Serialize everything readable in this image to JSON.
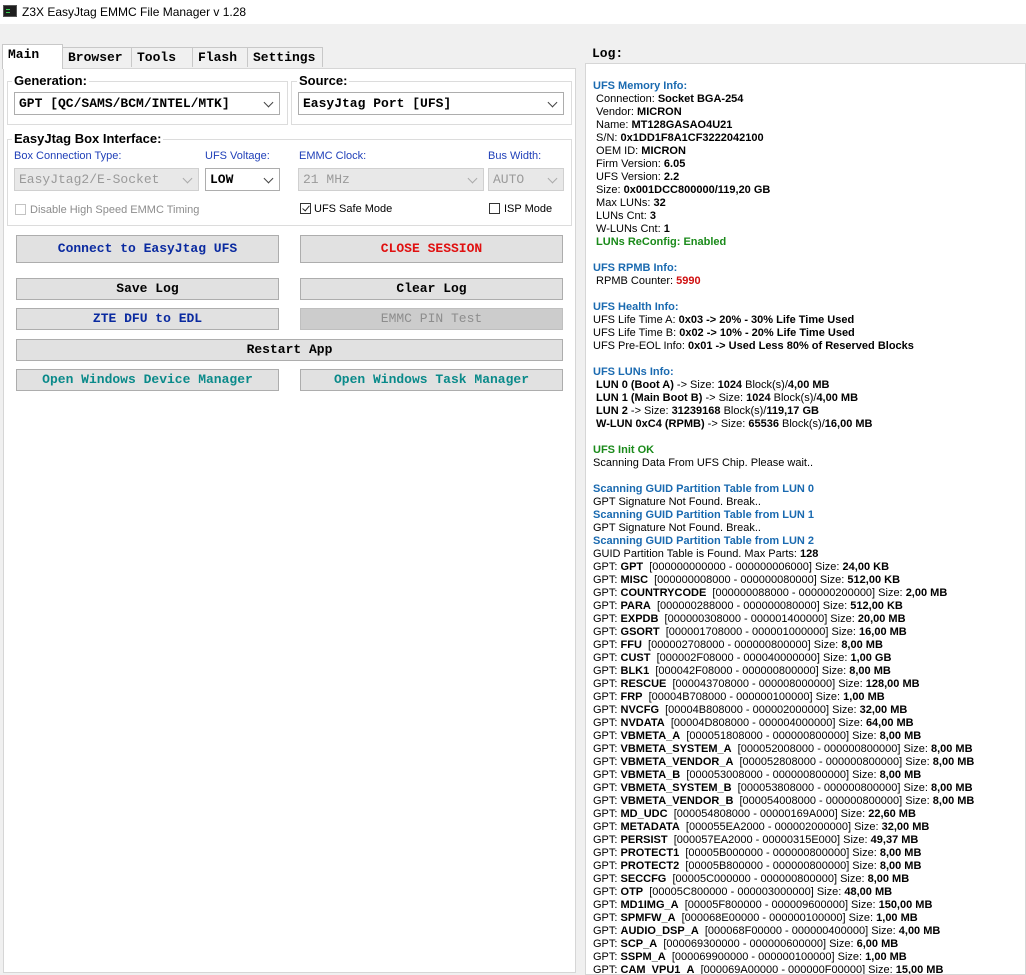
{
  "window": {
    "title": "Z3X EasyJtag EMMC File Manager v 1.28"
  },
  "tabs": [
    "Main",
    "Browser",
    "Tools",
    "Flash",
    "Settings"
  ],
  "generation": {
    "label": "Generation:",
    "value": "GPT [QC/SAMS/BCM/INTEL/MTK]"
  },
  "source": {
    "label": "Source:",
    "value": "EasyJtag Port [UFS]"
  },
  "box_interface": {
    "label": "EasyJtag Box Interface:",
    "conn_type": {
      "label": "Box Connection Type:",
      "value": "EasyJtag2/E-Socket"
    },
    "ufs_voltage": {
      "label": "UFS Voltage:",
      "value": "LOW"
    },
    "emmc_clock": {
      "label": "EMMC Clock:",
      "value": "21 MHz"
    },
    "bus_width": {
      "label": "Bus Width:",
      "value": "AUTO"
    },
    "disable_hs": {
      "label": "Disable High Speed EMMC Timing",
      "checked": false
    },
    "ufs_safe": {
      "label": "UFS Safe Mode",
      "checked": true
    },
    "isp_mode": {
      "label": "ISP Mode",
      "checked": false
    }
  },
  "buttons": {
    "connect": "Connect to EasyJtag UFS",
    "close": "CLOSE SESSION",
    "save_log": "Save Log",
    "clear_log": "Clear Log",
    "zte": "ZTE DFU to EDL",
    "emmc_pin": "EMMC PIN Test",
    "restart": "Restart App",
    "dev_mgr": "Open Windows Device Manager",
    "task_mgr": "Open Windows Task Manager"
  },
  "colors": {
    "connect": "#0a2aa0",
    "close": "#e01010",
    "zte": "#0a2aa0",
    "teal": "#0a8a8a"
  },
  "log": {
    "label": "Log:",
    "lines": [
      {
        "t": "sec",
        "a": "UFS Memory Info:"
      },
      {
        "t": "kv",
        "a": " Connection: ",
        "b": "Socket BGA-254"
      },
      {
        "t": "kv",
        "a": " Vendor: ",
        "b": "MICRON"
      },
      {
        "t": "kv",
        "a": " Name: ",
        "b": "MT128GASAO4U21"
      },
      {
        "t": "kv",
        "a": " S/N: ",
        "b": "0x1DD1F8A1CF3222042100"
      },
      {
        "t": "kv",
        "a": " OEM ID: ",
        "b": "MICRON"
      },
      {
        "t": "kv",
        "a": " Firm Version: ",
        "b": "6.05"
      },
      {
        "t": "kv",
        "a": " UFS Version: ",
        "b": "2.2"
      },
      {
        "t": "kv",
        "a": " Size: ",
        "b": "0x001DCC800000/119,20 GB"
      },
      {
        "t": "kv",
        "a": " Max LUNs: ",
        "b": "32"
      },
      {
        "t": "kv",
        "a": " LUNs Cnt: ",
        "b": "3"
      },
      {
        "t": "kv",
        "a": " W-LUNs Cnt: ",
        "b": "1"
      },
      {
        "t": "ok",
        "a": " LUNs ReConfig: Enabled"
      },
      {
        "t": "gap"
      },
      {
        "t": "sec",
        "a": "UFS RPMB Info:"
      },
      {
        "t": "kvr",
        "a": " RPMB Counter: ",
        "b": "5990"
      },
      {
        "t": "gap"
      },
      {
        "t": "sec",
        "a": "UFS Health Info:"
      },
      {
        "t": "kvk",
        "a": "UFS Life Time A: ",
        "b": "0x03 -> 20% - 30% Life Time Used"
      },
      {
        "t": "kvk",
        "a": "UFS Life Time B: ",
        "b": "0x02 -> 10% - 20% Life Time Used"
      },
      {
        "t": "kvk",
        "a": "UFS Pre-EOL Info: ",
        "b": "0x01 -> Used Less 80% of Reserved Blocks"
      },
      {
        "t": "gap"
      },
      {
        "t": "sec",
        "a": "UFS LUNs Info:"
      },
      {
        "t": "lun",
        "a": " LUN 0 (Boot A)",
        "b": " -> Size: ",
        "c": "1024",
        "d": " Block(s)/",
        "e": "4,00 MB"
      },
      {
        "t": "lun",
        "a": " LUN 1 (Main Boot B)",
        "b": " -> Size: ",
        "c": "1024",
        "d": " Block(s)/",
        "e": "4,00 MB"
      },
      {
        "t": "lun",
        "a": " LUN 2",
        "b": " -> Size: ",
        "c": "31239168",
        "d": " Block(s)/",
        "e": "119,17 GB"
      },
      {
        "t": "lun",
        "a": " W-LUN 0xC4 (RPMB)",
        "b": " -> Size: ",
        "c": "65536",
        "d": " Block(s)/",
        "e": "16,00 MB"
      },
      {
        "t": "gap"
      },
      {
        "t": "ok",
        "a": "UFS Init OK"
      },
      {
        "t": "plain",
        "a": "Scanning Data From UFS Chip. Please wait.."
      },
      {
        "t": "gap"
      },
      {
        "t": "sec",
        "a": "Scanning GUID Partition Table from LUN 0"
      },
      {
        "t": "plain",
        "a": "GPT Signature Not Found. Break.."
      },
      {
        "t": "sec",
        "a": "Scanning GUID Partition Table from LUN 1"
      },
      {
        "t": "plain",
        "a": "GPT Signature Not Found. Break.."
      },
      {
        "t": "sec",
        "a": "Scanning GUID Partition Table from LUN 2"
      },
      {
        "t": "kv",
        "a": "GUID Partition Table is Found. Max Parts: ",
        "b": "128"
      },
      {
        "t": "gpt",
        "a": "GPT",
        "r": "000000000000 - 000000006000",
        "s": "24,00 KB"
      },
      {
        "t": "gpt",
        "a": "MISC",
        "r": "000000008000 - 000000080000",
        "s": "512,00 KB"
      },
      {
        "t": "gpt",
        "a": "COUNTRYCODE",
        "r": "000000088000 - 000000200000",
        "s": "2,00 MB"
      },
      {
        "t": "gpt",
        "a": "PARA",
        "r": "000000288000 - 000000080000",
        "s": "512,00 KB"
      },
      {
        "t": "gpt",
        "a": "EXPDB",
        "r": "000000308000 - 000001400000",
        "s": "20,00 MB"
      },
      {
        "t": "gpt",
        "a": "GSORT",
        "r": "000001708000 - 000001000000",
        "s": "16,00 MB"
      },
      {
        "t": "gpt",
        "a": "FFU",
        "r": "000002708000 - 000000800000",
        "s": "8,00 MB"
      },
      {
        "t": "gpt",
        "a": "CUST",
        "r": "000002F08000 - 000040000000",
        "s": "1,00 GB"
      },
      {
        "t": "gpt",
        "a": "BLK1",
        "r": "000042F08000 - 000000800000",
        "s": "8,00 MB"
      },
      {
        "t": "gpt",
        "a": "RESCUE",
        "r": "000043708000 - 000008000000",
        "s": "128,00 MB"
      },
      {
        "t": "gpt",
        "a": "FRP",
        "r": "00004B708000 - 000000100000",
        "s": "1,00 MB"
      },
      {
        "t": "gpt",
        "a": "NVCFG",
        "r": "00004B808000 - 000002000000",
        "s": "32,00 MB"
      },
      {
        "t": "gpt",
        "a": "NVDATA",
        "r": "00004D808000 - 000004000000",
        "s": "64,00 MB"
      },
      {
        "t": "gpt",
        "a": "VBMETA_A",
        "r": "000051808000 - 000000800000",
        "s": "8,00 MB"
      },
      {
        "t": "gpt",
        "a": "VBMETA_SYSTEM_A",
        "r": "000052008000 - 000000800000",
        "s": "8,00 MB"
      },
      {
        "t": "gpt",
        "a": "VBMETA_VENDOR_A",
        "r": "000052808000 - 000000800000",
        "s": "8,00 MB"
      },
      {
        "t": "gpt",
        "a": "VBMETA_B",
        "r": "000053008000 - 000000800000",
        "s": "8,00 MB"
      },
      {
        "t": "gpt",
        "a": "VBMETA_SYSTEM_B",
        "r": "000053808000 - 000000800000",
        "s": "8,00 MB"
      },
      {
        "t": "gpt",
        "a": "VBMETA_VENDOR_B",
        "r": "000054008000 - 000000800000",
        "s": "8,00 MB"
      },
      {
        "t": "gpt",
        "a": "MD_UDC",
        "r": "000054808000 - 00000169A000",
        "s": "22,60 MB"
      },
      {
        "t": "gpt",
        "a": "METADATA",
        "r": "000055EA2000 - 000002000000",
        "s": "32,00 MB"
      },
      {
        "t": "gpt",
        "a": "PERSIST",
        "r": "000057EA2000 - 00000315E000",
        "s": "49,37 MB"
      },
      {
        "t": "gpt",
        "a": "PROTECT1",
        "r": "00005B000000 - 000000800000",
        "s": "8,00 MB"
      },
      {
        "t": "gpt",
        "a": "PROTECT2",
        "r": "00005B800000 - 000000800000",
        "s": "8,00 MB"
      },
      {
        "t": "gpt",
        "a": "SECCFG",
        "r": "00005C000000 - 000000800000",
        "s": "8,00 MB"
      },
      {
        "t": "gpt",
        "a": "OTP",
        "r": "00005C800000 - 000003000000",
        "s": "48,00 MB"
      },
      {
        "t": "gpt",
        "a": "MD1IMG_A",
        "r": "00005F800000 - 000009600000",
        "s": "150,00 MB"
      },
      {
        "t": "gpt",
        "a": "SPMFW_A",
        "r": "000068E00000 - 000000100000",
        "s": "1,00 MB"
      },
      {
        "t": "gpt",
        "a": "AUDIO_DSP_A",
        "r": "000068F00000 - 000000400000",
        "s": "4,00 MB"
      },
      {
        "t": "gpt",
        "a": "SCP_A",
        "r": "000069300000 - 000000600000",
        "s": "6,00 MB"
      },
      {
        "t": "gpt",
        "a": "SSPM_A",
        "r": "000069900000 - 000000100000",
        "s": "1,00 MB"
      },
      {
        "t": "gpt",
        "a": "CAM_VPU1_A",
        "r": "000069A00000 - 000000F00000",
        "s": "15,00 MB"
      }
    ]
  }
}
